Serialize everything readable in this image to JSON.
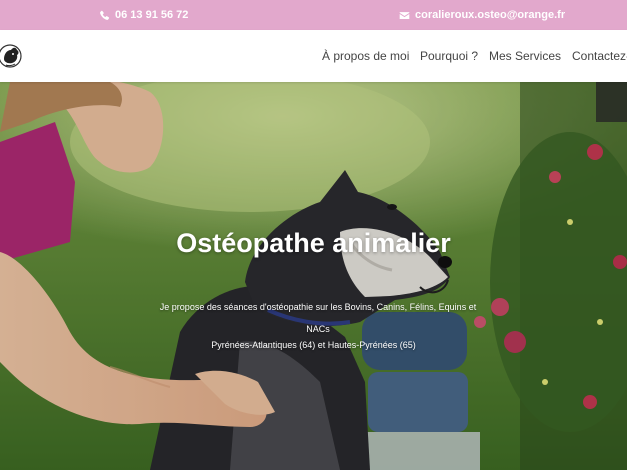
{
  "topbar": {
    "phone": "06 13 91 56 72",
    "email": "coralieroux.osteo@orange.fr",
    "phone_icon": "phone-icon",
    "email_icon": "envelope-icon",
    "background_color": "#e2a8cc"
  },
  "nav": {
    "logo_icon": "dog-logo-icon",
    "items": [
      {
        "label": "À propos de moi"
      },
      {
        "label": "Pourquoi ?"
      },
      {
        "label": "Mes Services"
      },
      {
        "label": "Contactez-moi"
      }
    ]
  },
  "hero": {
    "title": "Ostéopathe animalier",
    "description": "Je propose des séances d'ostéopathie sur les Bovins, Canins, Félins, Equins et NACs",
    "region": "Pyrénées-Atlantiques (64) et Hautes-Pyrénées (65)"
  }
}
